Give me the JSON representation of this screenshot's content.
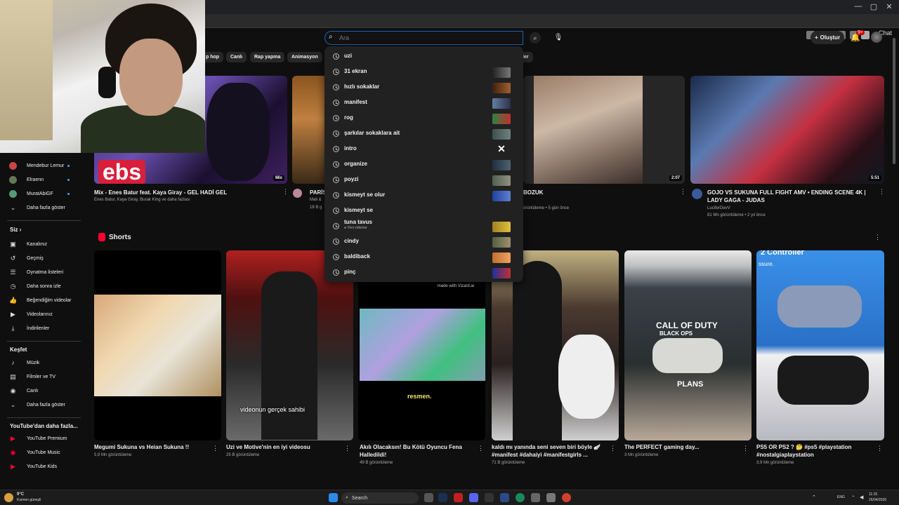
{
  "browser": {
    "chat_label": "Chat",
    "window_controls": [
      "—",
      "▢",
      "✕"
    ]
  },
  "header": {
    "search_placeholder": "Ara",
    "create_label": "Oluştur",
    "notification_count": "9+"
  },
  "chips": [
    "p hop",
    "Canlı",
    "Rap yapma",
    "Animasyon",
    "iler"
  ],
  "sidebar": {
    "subscriptions": [
      {
        "label": "Mendebur Lemur",
        "live": true
      },
      {
        "label": "Elraenn",
        "live": true
      },
      {
        "label": "MuratAbiGF",
        "live": true
      }
    ],
    "show_more_1": "Daha fazla göster",
    "you_heading": "Siz",
    "you_items": [
      "Kanalınız",
      "Geçmiş",
      "Oynatma listeleri",
      "Daha sonra izle",
      "Beğendiğim videolar",
      "Videolarınız",
      "İndirilenler"
    ],
    "explore_heading": "Keşfet",
    "explore_items": [
      "Müzik",
      "Filmler ve TV",
      "Canlı"
    ],
    "show_more_2": "Daha fazla göster",
    "more_heading": "YouTube'dan daha fazla...",
    "more_items": [
      "YouTube Premium",
      "YouTube Music",
      "YouTube Kids"
    ]
  },
  "videos": [
    {
      "title": "Mix - Enes Batur feat. Kaya Giray - GEL HADİ GEL",
      "meta": "Enes Batur, Kaya Giray, Burak King ve daha fazlası",
      "badge": "Mix",
      "thumb_text": "ebs"
    },
    {
      "title": "PARİS",
      "meta1": "Mali &",
      "meta2": "18 B g"
    },
    {
      "title": "BOZUK",
      "meta": "örüntüleme • 5 gün önce",
      "duration": "2:07"
    },
    {
      "title": "GOJO VS SUKUNA FULL FIGHT AMV • ENDING SCENE 4K | LADY GAGA - JUDAS",
      "channel": "LuciferDevV",
      "meta": "81 Mn görüntüleme • 2 yıl önce",
      "duration": "5:51"
    }
  ],
  "shorts": {
    "heading": "Shorts",
    "items": [
      {
        "title": "Megumi Sukuna vs Heian Sukuna !!",
        "meta": "5,9 Mn görüntüleme"
      },
      {
        "title": "Uzi ve Motive'nin en iyi videosu",
        "meta": "25 B görüntüleme",
        "overlay": "videonun gerçek sahibi"
      },
      {
        "title": "Akılı Olacaksın! Bu Kötü Oyuncu Fena Halledildi!",
        "meta": "49 B görüntüleme",
        "overlay": "resmen.",
        "brand": "made with Vizard.ai"
      },
      {
        "title": "kaldı mı yanında seni seven biri böyle 🪽 #manifest #dahaiyi #manifestgirls ...",
        "meta": "71 B görüntüleme"
      },
      {
        "title": "The PERFECT gaming day...",
        "meta": "3 Mn görüntüleme",
        "overlay1": "CALL OF DUTY",
        "overlay2": "BLACK OPS",
        "overlay3": "PLANS"
      },
      {
        "title": "PS5 OR PS2 ? 🤔 #ps5 #playstation #nostalgiaplaystation",
        "meta": "3,9 Mn görüntüleme",
        "overlay": "2 Controller",
        "overlay_b": "ssure."
      }
    ]
  },
  "suggestions": [
    {
      "text": "uzi"
    },
    {
      "text": "31 ekran"
    },
    {
      "text": "hızlı sokaklar"
    },
    {
      "text": "manifest"
    },
    {
      "text": "rog"
    },
    {
      "text": "şarkılar sokaklara ait"
    },
    {
      "text": "intro",
      "close": "✕"
    },
    {
      "text": "organize"
    },
    {
      "text": "poyzi"
    },
    {
      "text": "kismeyt se olur"
    },
    {
      "text": "kismeyt se"
    },
    {
      "text": "tuna tavus",
      "sub": "● Yeni videolar"
    },
    {
      "text": "cindy"
    },
    {
      "text": "baldiback"
    },
    {
      "text": "pinç"
    }
  ],
  "taskbar": {
    "weather_temp": "9°C",
    "weather_desc": "Kısmen güneşli",
    "search_label": "Search",
    "lang": "ENG",
    "time": "11:15",
    "date": "26/04/2026"
  },
  "colors": {
    "accent": "#3ea6ff",
    "search_border": "#1c62b9",
    "youtube_red": "#ff0033"
  }
}
